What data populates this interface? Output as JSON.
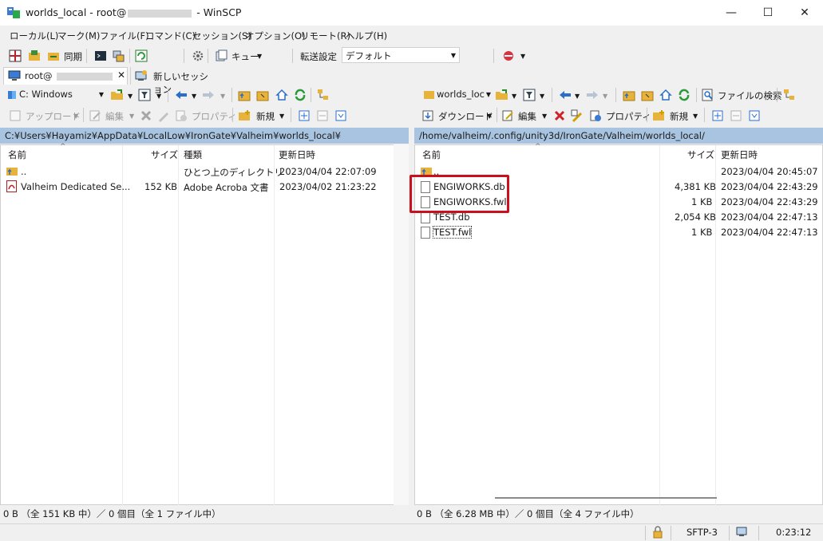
{
  "window": {
    "title_prefix": "worlds_local - root@",
    "title_suffix": " - WinSCP",
    "minimize": "—",
    "maximize": "☐",
    "close": "✕"
  },
  "menu": [
    "ローカル(L)",
    "マーク(M)",
    "ファイル(F)",
    "コマンド(C)",
    "セッション(S)",
    "オプション(O)",
    "リモート(R)",
    "ヘルプ(H)"
  ],
  "toolbar": {
    "sync_label": "同期",
    "queue_label": "キュー",
    "transfer_label": "転送設定",
    "transfer_value": "デフォルト"
  },
  "tabs": {
    "session_label": "root@",
    "close_icon": "✕",
    "new_session_label": "新しいセッション"
  },
  "left": {
    "drive": "C: Windows",
    "upload_label": "アップロード",
    "edit_label": "編集",
    "properties_label": "プロパティ",
    "new_label": "新規",
    "path": "C:¥Users¥Hayamiz¥AppData¥LocalLow¥IronGate¥Valheim¥worlds_local¥",
    "columns": {
      "name": "名前",
      "size": "サイズ",
      "type": "種類",
      "modified": "更新日時"
    },
    "rows": [
      {
        "name": "..",
        "size": "",
        "type": "ひとつ上のディレクトリ",
        "modified": "2023/04/04  22:07:09",
        "icon": "parent-folder"
      },
      {
        "name": "Valheim Dedicated Se...",
        "size": "152 KB",
        "type": "Adobe Acroba 文書",
        "modified": "2023/04/02  21:23:22",
        "icon": "pdf"
      }
    ],
    "status": "0 B （全 151 KB 中）／ 0 個目（全 1 ファイル中）"
  },
  "right": {
    "folder": "worlds_loc",
    "download_label": "ダウンロード",
    "edit_label": "編集",
    "properties_label": "プロパティ",
    "new_label": "新規",
    "search_label": "ファイルの検索",
    "path": "/home/valheim/.config/unity3d/IronGate/Valheim/worlds_local/",
    "columns": {
      "name": "名前",
      "size": "サイズ",
      "modified": "更新日時"
    },
    "rows": [
      {
        "name": "..",
        "size": "",
        "modified": "2023/04/04 20:45:07",
        "icon": "parent-folder"
      },
      {
        "name": "ENGIWORKS.db",
        "size": "4,381 KB",
        "modified": "2023/04/04 22:43:29",
        "icon": "db-file"
      },
      {
        "name": "ENGIWORKS.fwl",
        "size": "1 KB",
        "modified": "2023/04/04 22:43:29",
        "icon": "file"
      },
      {
        "name": "TEST.db",
        "size": "2,054 KB",
        "modified": "2023/04/04 22:47:13",
        "icon": "db-file"
      },
      {
        "name": "TEST.fwl",
        "size": "1 KB",
        "modified": "2023/04/04 22:47:13",
        "icon": "file"
      }
    ],
    "status": "0 B （全 6.28 MB 中）／ 0 個目（全 4 ファイル中）"
  },
  "statusbar": {
    "protocol": "SFTP-3",
    "time": "0:23:12"
  },
  "colors": {
    "highlight": "#c8101e",
    "path_bg": "#a9c4e0"
  }
}
